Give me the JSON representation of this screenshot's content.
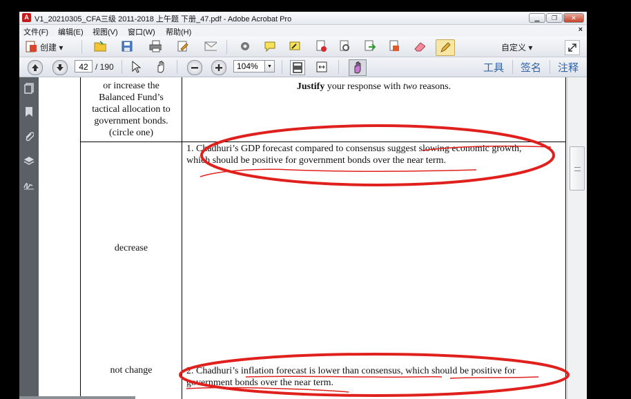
{
  "window": {
    "title": "V1_20210305_CFA三级 2011-2018 上午题  下册_47.pdf - Adobe Acrobat Pro",
    "app_icon_glyph": "A"
  },
  "menu": {
    "items": [
      "文件(F)",
      "编辑(E)",
      "视图(V)",
      "窗口(W)",
      "帮助(H)"
    ],
    "close_glyph": "×"
  },
  "toolbar": {
    "create_label": "创建 ▾",
    "custom_label": "自定义 ▾"
  },
  "nav": {
    "current_page": "42",
    "page_count": "/ 190",
    "zoom": "104%"
  },
  "right_links": [
    "工具",
    "签名",
    "注释"
  ],
  "document": {
    "header_left": "or increase the\nBalanced Fund’s\ntactical allocation to\ngovernment bonds.\n(circle one)",
    "header_right_bold": "Justify",
    "header_right_mid": " your response with ",
    "header_right_italic": "two",
    "header_right_end": " reasons.",
    "row1_label": "decrease",
    "row1_answer_line1": "1. Chadhuri’s GDP forecast compared to consensus suggest slowing economic growth,",
    "row1_answer_line2": "which should be positive for government bonds over the near term.",
    "row2_label": "not change",
    "row2_answer_line1": "2. Chadhuri’s inflation forecast is lower than consensus, which should be positive for",
    "row2_answer_line2": "government bonds over the near term."
  },
  "colors": {
    "annotation_red": "#e0201c",
    "link_blue": "#2f64a8"
  }
}
